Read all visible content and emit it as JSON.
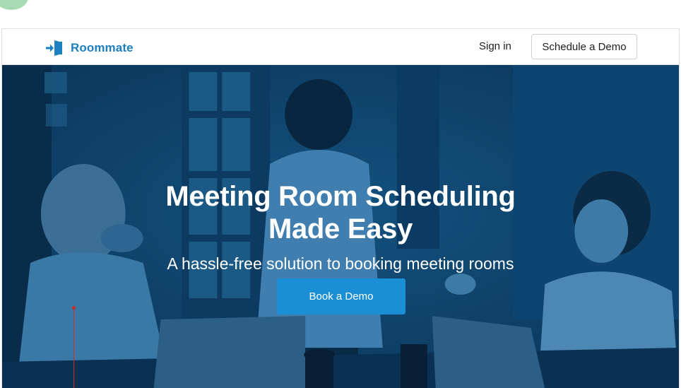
{
  "nav": {
    "logo_text": "Roommate",
    "signin_label": "Sign in",
    "demo_label": "Schedule a Demo"
  },
  "hero": {
    "title_line1": "Meeting Room Scheduling",
    "title_line2": "Made Easy",
    "subtitle": "A hassle-free solution to booking meeting rooms",
    "cta_label": "Book a Demo"
  },
  "colors": {
    "brand": "#1b7fc0",
    "hero_overlay": "#0b3e64",
    "cta": "#1a8fd6",
    "indicator": "#a8dbb1",
    "pointer": "#d22a2a"
  },
  "icons": {
    "logo": "door-enter-icon"
  }
}
